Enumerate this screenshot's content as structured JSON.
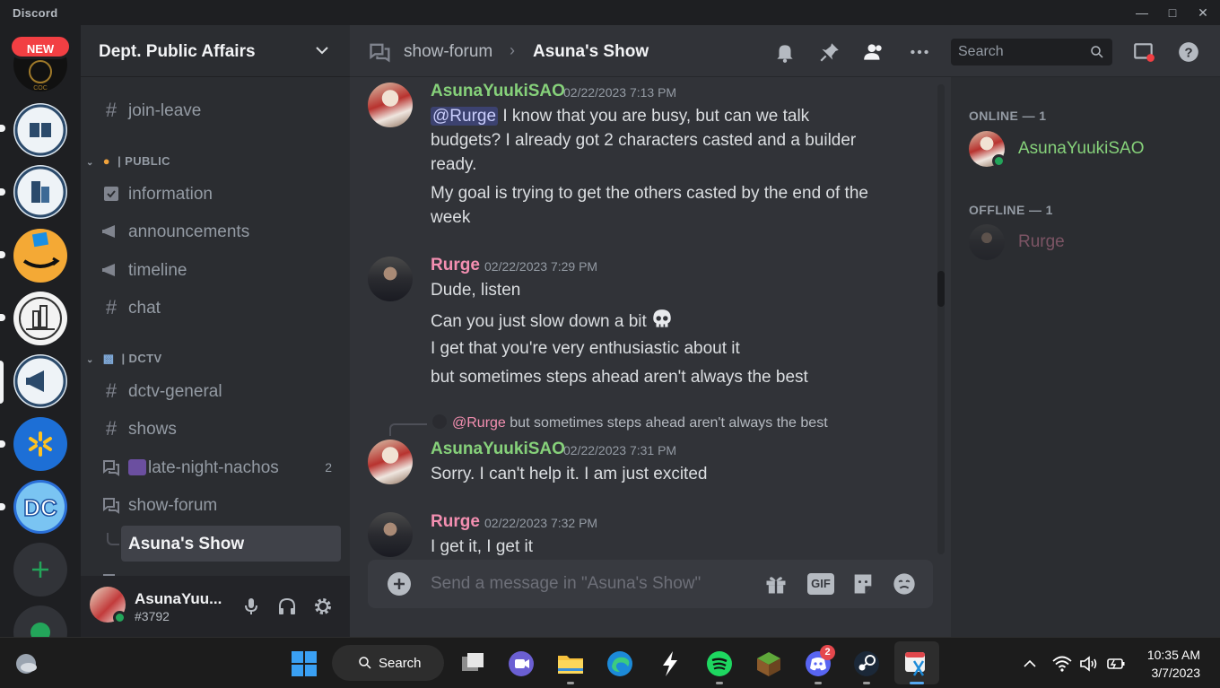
{
  "window": {
    "app_name": "Discord",
    "new_badge": "NEW"
  },
  "guild": {
    "name": "Dept. Public Affairs"
  },
  "channels": [
    {
      "label": "join-leave",
      "icon": "hash-icon"
    },
    {
      "category": "| PUBLIC",
      "emoji": "person-emoji"
    },
    {
      "label": "information",
      "icon": "checkbox-icon"
    },
    {
      "label": "announcements",
      "icon": "megaphone-icon"
    },
    {
      "label": "timeline",
      "icon": "megaphone-icon"
    },
    {
      "label": "chat",
      "icon": "hash-icon"
    },
    {
      "category": "| DCTV",
      "emoji": "tv-emoji"
    },
    {
      "label": "dctv-general",
      "icon": "hash-icon"
    },
    {
      "label": "shows",
      "icon": "hash-icon"
    },
    {
      "label": "late-night-nachos",
      "icon": "forum-icon",
      "count": "2"
    },
    {
      "label": "show-forum",
      "icon": "forum-icon"
    },
    {
      "label": "Asuna's Show",
      "icon": "thread-icon",
      "active": true
    }
  ],
  "user": {
    "name": "AsunaYuu...",
    "tag": "#3792",
    "status_color": "#23a55a"
  },
  "header": {
    "parent_channel": "show-forum",
    "separator": "›",
    "thread_title": "Asuna's Show",
    "search_placeholder": "Search"
  },
  "messages": [
    {
      "author": "AsunaYuukiSAO",
      "timestamp": "02/22/2023 7:13 PM",
      "color": "#86d17a",
      "mention": "@Rurge",
      "lines": [
        " I know that you are busy, but can we talk",
        "budgets? I already got 2 characters casted and a builder",
        "ready.",
        "My goal is trying to get the others casted by the end of the",
        "week"
      ]
    },
    {
      "author": "Rurge",
      "timestamp": "02/22/2023 7:29 PM",
      "color": "#f48fb1",
      "lines": [
        "Dude, listen",
        "Can you just slow down a bit",
        "I get that you're very enthusiastic about it",
        "but sometimes steps ahead aren't always the best"
      ]
    },
    {
      "reply_mention": "@Rurge",
      "reply_text": "but sometimes steps ahead aren't always the best",
      "author": "AsunaYuukiSAO",
      "timestamp": "02/22/2023 7:31 PM",
      "color": "#86d17a",
      "lines": [
        "Sorry. I can't help it. I am just excited"
      ]
    },
    {
      "author": "Rurge",
      "timestamp": "02/22/2023 7:32 PM",
      "color": "#f48fb1",
      "lines": [
        "I get it, I get it"
      ]
    }
  ],
  "composer": {
    "placeholder": "Send a message in \"Asuna's Show\"",
    "gif_label": "GIF"
  },
  "members": {
    "online_header": "ONLINE — 1",
    "offline_header": "OFFLINE — 1",
    "online": [
      {
        "name": "AsunaYuukiSAO",
        "color": "#86d17a"
      }
    ],
    "offline": [
      {
        "name": "Rurge",
        "color": "#f48fb1"
      }
    ]
  },
  "taskbar": {
    "search_label": "Search",
    "time": "10:35 AM",
    "date": "3/7/2023",
    "discord_badge": "2"
  }
}
